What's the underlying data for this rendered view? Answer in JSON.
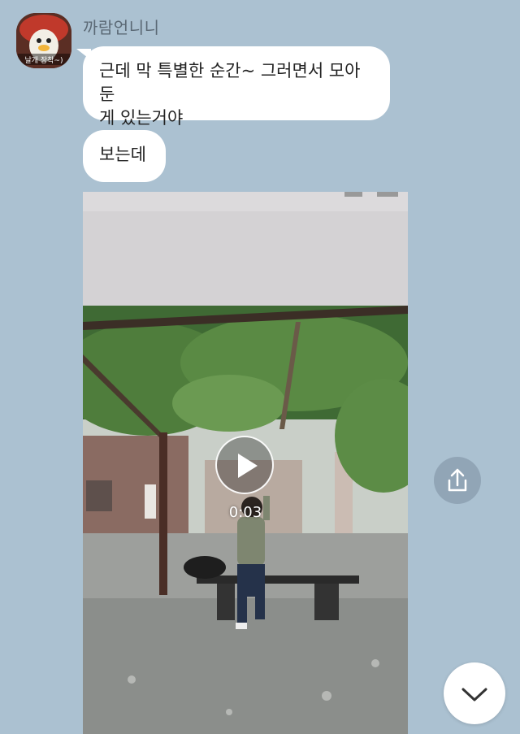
{
  "chat": {
    "sender_name": "까람언니니",
    "avatar_caption": "날개 장착~)",
    "messages": [
      {
        "type": "text",
        "text": "근데 막 특별한 순간~ 그러면서 모아둔\n게 있는거야"
      },
      {
        "type": "text",
        "text": "보는데"
      }
    ],
    "video": {
      "duration": "0:03"
    }
  },
  "icons": {
    "play": "play-icon",
    "share": "share-icon",
    "scroll_down": "chevron-down-icon"
  },
  "colors": {
    "background": "#abc1d1",
    "bubble": "#ffffff"
  }
}
